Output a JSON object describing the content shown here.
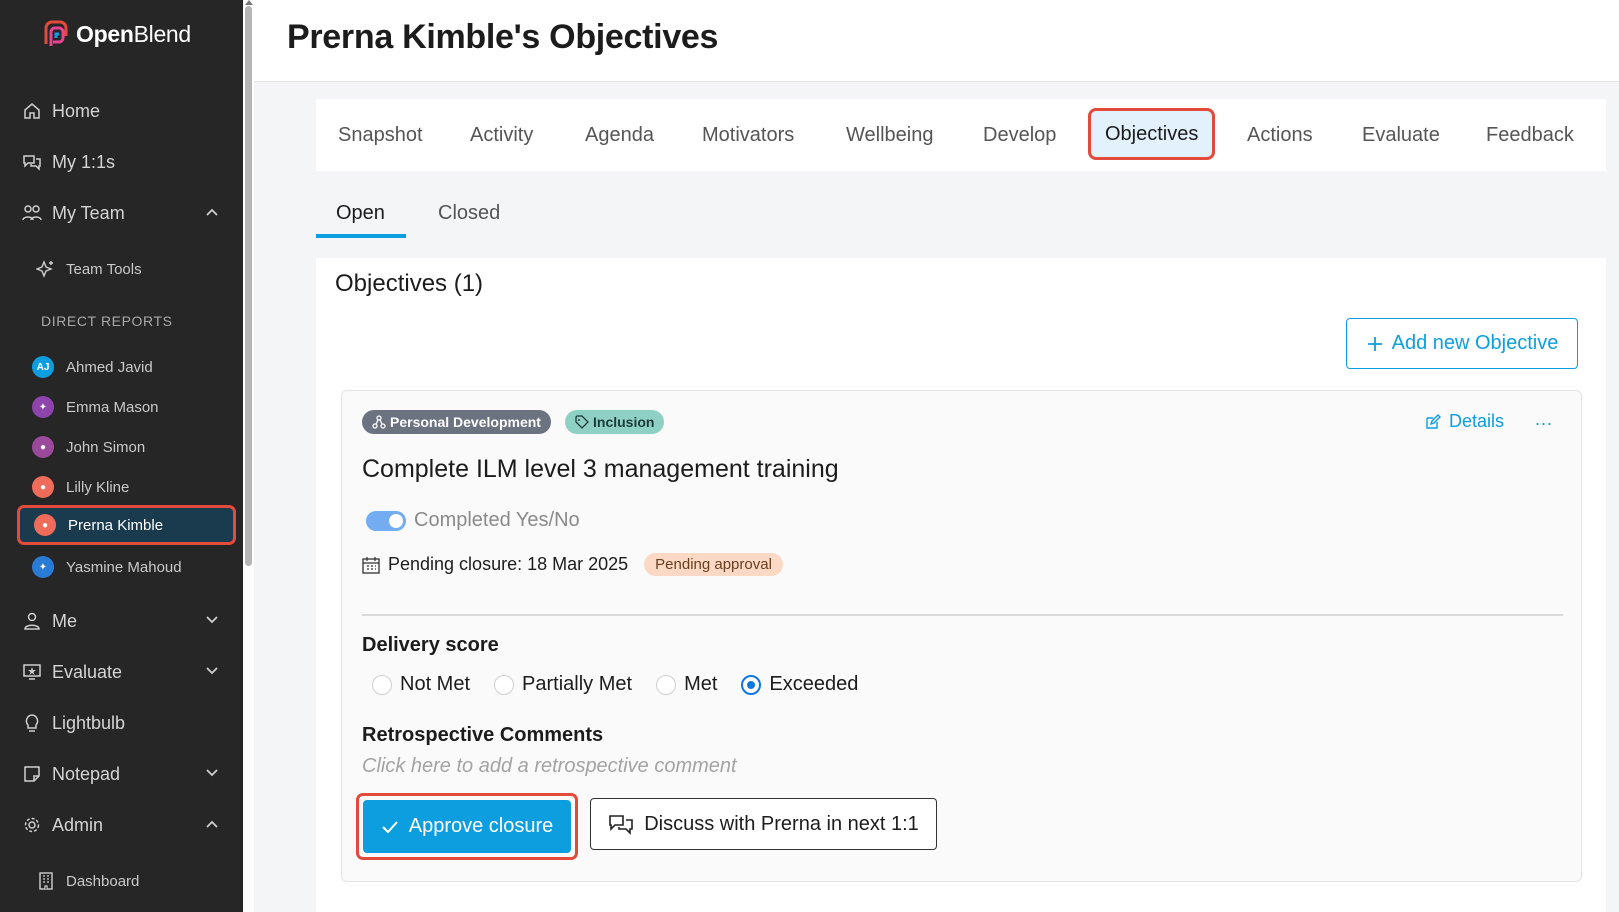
{
  "app": {
    "logo_bold": "Open",
    "logo_light": "Blend"
  },
  "sidebar": {
    "nav": {
      "home": "Home",
      "my_1_1s": "My 1:1s",
      "my_team": "My Team",
      "team_tools": "Team Tools",
      "me": "Me",
      "evaluate": "Evaluate",
      "lightbulb": "Lightbulb",
      "notepad": "Notepad",
      "admin": "Admin",
      "dashboard": "Dashboard"
    },
    "section_label": "DIRECT REPORTS",
    "reports": [
      {
        "name": "Ahmed Javid",
        "initials": "AJ",
        "color": "#0d9ee0"
      },
      {
        "name": "Emma Mason",
        "initials": "",
        "color": "#8e44ad"
      },
      {
        "name": "John Simon",
        "initials": "",
        "color": "#9b4a9b"
      },
      {
        "name": "Lilly Kline",
        "initials": "",
        "color": "#ef6c5a"
      },
      {
        "name": "Prerna Kimble",
        "initials": "",
        "color": "#ef6c5a"
      },
      {
        "name": "Yasmine Mahoud",
        "initials": "",
        "color": "#2a7bd6"
      }
    ],
    "active_report": "Prerna Kimble"
  },
  "header": {
    "title": "Prerna Kimble's Objectives"
  },
  "tabs": [
    {
      "label": "Snapshot"
    },
    {
      "label": "Activity"
    },
    {
      "label": "Agenda"
    },
    {
      "label": "Motivators"
    },
    {
      "label": "Wellbeing"
    },
    {
      "label": "Develop"
    },
    {
      "label": "Objectives"
    },
    {
      "label": "Actions"
    },
    {
      "label": "Evaluate"
    },
    {
      "label": "Feedback"
    }
  ],
  "active_tab": "Objectives",
  "subtabs": {
    "open": "Open",
    "closed": "Closed",
    "active": "Open"
  },
  "objectives": {
    "count_label": "Objectives (1)",
    "add_button": "Add new Objective",
    "card": {
      "tag_category": "Personal Development",
      "tag_theme": "Inclusion",
      "details_label": "Details",
      "more_label": "...",
      "title": "Complete ILM level 3 management training",
      "completed_label": "Completed Yes/No",
      "completed_on": true,
      "pending_closure": "Pending closure: 18 Mar 2025",
      "pending_badge": "Pending approval",
      "delivery_score_label": "Delivery score",
      "score_options": [
        "Not Met",
        "Partially Met",
        "Met",
        "Exceeded"
      ],
      "score_selected": "Exceeded",
      "retro_label": "Retrospective Comments",
      "retro_placeholder": "Click here to add a retrospective comment",
      "approve_button": "Approve closure",
      "discuss_button": "Discuss with Prerna in next 1:1"
    }
  },
  "colors": {
    "accent": "#0d9ee0",
    "highlight": "#e24a3b",
    "sidebar_bg": "#262626"
  }
}
